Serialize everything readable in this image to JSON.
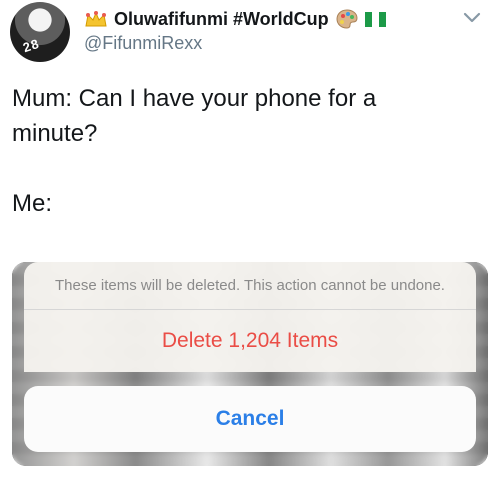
{
  "header": {
    "display_name": "Oluwafifunmi #WorldCup",
    "handle": "@FifunmiRexx",
    "avatar_text": "28",
    "emoji_icons": [
      "crown-icon",
      "palette-icon",
      "nigeria-flag-icon"
    ],
    "menu_icon": "chevron-down-icon"
  },
  "tweet": {
    "text": "Mum: Can I have your phone for a\nminute?\n\nMe:"
  },
  "action_sheet": {
    "message": "These items will be deleted. This action cannot be undone.",
    "delete_label": "Delete 1,204 Items",
    "cancel_label": "Cancel",
    "colors": {
      "delete": "#ea4d46",
      "cancel": "#2b7fe7",
      "message": "#8a8a8a"
    }
  }
}
